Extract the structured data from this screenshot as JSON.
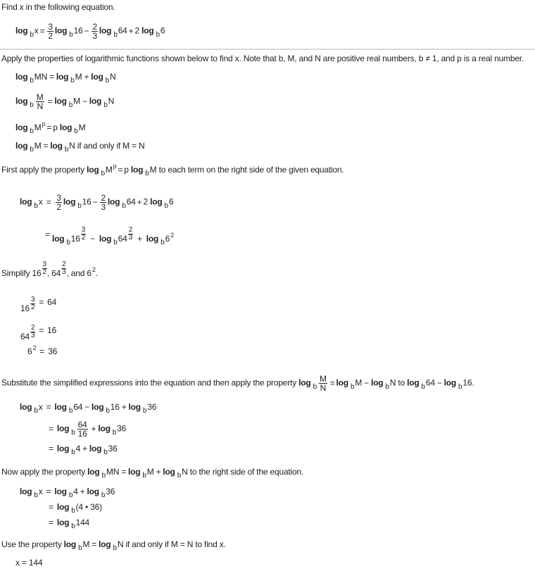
{
  "problem": {
    "prompt": "Find x in the following equation.",
    "equation": {
      "lhs_log": "log",
      "base": "b",
      "lhs_arg": "x",
      "eq": "=",
      "t1_num": "3",
      "t1_den": "2",
      "t1_log": "log",
      "t1_arg": "16",
      "minus": "−",
      "t2_num": "2",
      "t2_den": "3",
      "t2_log": "log",
      "t2_arg": "64",
      "plus": "+",
      "t3_coef": "2",
      "t3_log": "log",
      "t3_arg": "6"
    }
  },
  "properties": {
    "intro": "Apply the properties of logarithmic functions shown below to find x. Note that b, M, and N are positive real numbers, b ≠ 1, and p is a real number.",
    "log": "log",
    "base": "b",
    "M": "M",
    "N": "N",
    "MN": "MN",
    "p": "p",
    "eq": "=",
    "plus": "+",
    "minus": "−",
    "iff": "if and only if",
    "MeqN": "M = N"
  },
  "step1": {
    "text_before": "First apply the property",
    "text_after": "to each term on the right side of the given equation.",
    "exp_3": "3",
    "exp_2": "2",
    "exp_2b": "2",
    "exp_3b": "3",
    "exp_sq": "2",
    "a16": "16",
    "a64": "64",
    "a6": "6",
    "coef2": "2",
    "x": "x"
  },
  "step2": {
    "simplify": "Simplify",
    "comma": ",",
    "and": ", and",
    "period": ".",
    "results": [
      {
        "base": "16",
        "num": "3",
        "den": "2",
        "value": "64"
      },
      {
        "base": "64",
        "num": "2",
        "den": "3",
        "value": "16"
      },
      {
        "base": "6",
        "exp": "2",
        "value": "36"
      }
    ]
  },
  "step3": {
    "text_before": "Substitute the simplified expressions into the equation and then apply the property",
    "to": "to",
    "a64": "64",
    "a16": "16",
    "a36": "36",
    "a4": "4",
    "period": "."
  },
  "step4": {
    "text_before": "Now apply the property",
    "text_after": "to the right side of the equation.",
    "product": "(4 • 36)",
    "a144": "144"
  },
  "step5": {
    "text_before": "Use the property",
    "text_after": "to find x.",
    "answer": "x = 144"
  }
}
